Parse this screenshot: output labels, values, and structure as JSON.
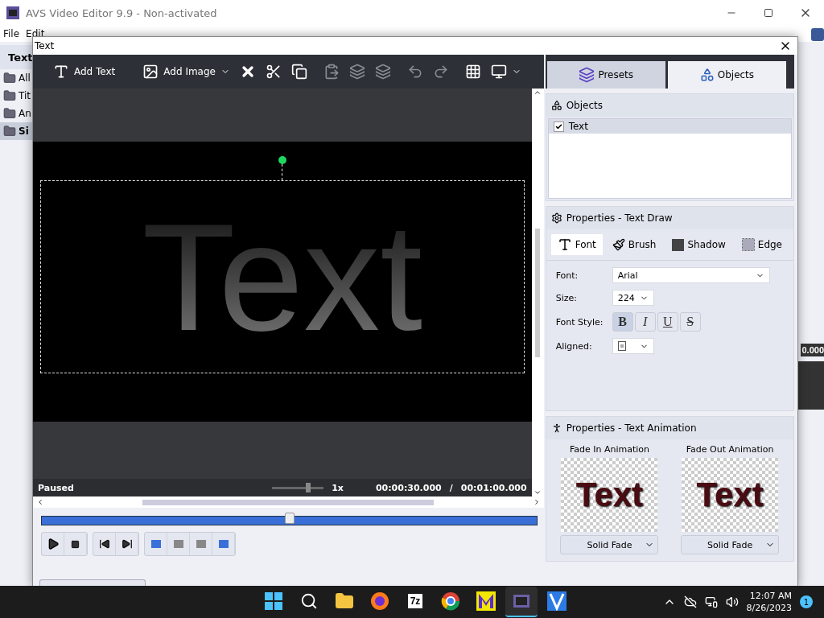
{
  "app": {
    "title": "AVS Video Editor 9.9 - Non-activated",
    "menu": [
      "File",
      "Edit"
    ],
    "sidebar_title": "Text",
    "folders": [
      {
        "label": "All",
        "selected": false
      },
      {
        "label": "Tit",
        "selected": false
      },
      {
        "label": "An",
        "selected": false
      },
      {
        "label": "Si",
        "selected": true
      }
    ],
    "side_reading": "0.000"
  },
  "dialog": {
    "title": "Text"
  },
  "toolbar": [
    {
      "kind": "text",
      "label": "Add Text",
      "disabled": false
    },
    {
      "kind": "image",
      "label": "Add Image",
      "disabled": false
    },
    {
      "kind": "delete",
      "disabled": false
    },
    {
      "kind": "cut",
      "disabled": false
    },
    {
      "kind": "copy",
      "disabled": false
    },
    {
      "kind": "paste",
      "disabled": true
    },
    {
      "kind": "forward",
      "disabled": true
    },
    {
      "kind": "backward",
      "disabled": true
    },
    {
      "kind": "undo",
      "disabled": true
    },
    {
      "kind": "redo",
      "disabled": true
    },
    {
      "kind": "grid",
      "disabled": false
    },
    {
      "kind": "display",
      "disabled": false
    }
  ],
  "tabs": [
    {
      "label": "Presets",
      "selected": false
    },
    {
      "label": "Objects",
      "selected": true
    }
  ],
  "objects": {
    "title": "Objects",
    "items": [
      {
        "label": "Text",
        "checked": true,
        "selected": true
      }
    ]
  },
  "properties": {
    "title": "Properties - Text Draw",
    "subtabs": [
      {
        "kind": "font",
        "label": "Font",
        "selected": true
      },
      {
        "kind": "brush",
        "label": "Brush",
        "selected": false
      },
      {
        "kind": "shadow",
        "label": "Shadow",
        "selected": false
      },
      {
        "kind": "edge",
        "label": "Edge",
        "selected": false
      }
    ],
    "font_label": "Font:",
    "font": "Arial",
    "size_label": "Size:",
    "size": "224",
    "style_label": "Font Style:",
    "styles": [
      {
        "kind": "bold",
        "glyph": "B",
        "on": true
      },
      {
        "kind": "italic",
        "glyph": "I",
        "on": false
      },
      {
        "kind": "underline",
        "glyph": "U",
        "on": false
      },
      {
        "kind": "strike",
        "glyph": "S",
        "on": false
      }
    ],
    "aligned_label": "Aligned:"
  },
  "animation": {
    "title": "Properties - Text Animation",
    "items": [
      {
        "title": "Fade In Animation",
        "sample": "Text",
        "effect": "Solid Fade"
      },
      {
        "title": "Fade Out Animation",
        "sample": "Text",
        "effect": "Solid Fade"
      }
    ]
  },
  "preview": {
    "text": "Text",
    "status": "Paused",
    "speed": {
      "level": 0.7
    },
    "speed_reading": "1x",
    "time": "00:00:30.000",
    "separator": "/",
    "duration": "00:01:00.000"
  },
  "timeline": {
    "level": 0.5
  },
  "taskbar": {
    "apps": [
      {
        "kind": "start",
        "active": false
      },
      {
        "kind": "search",
        "active": false
      },
      {
        "kind": "folder",
        "active": false
      },
      {
        "kind": "browser-fox",
        "active": false
      },
      {
        "kind": "archiver",
        "label": "7z",
        "active": false
      },
      {
        "kind": "browser-round",
        "active": false
      },
      {
        "kind": "m-app",
        "active": false
      },
      {
        "kind": "film",
        "active": true
      },
      {
        "kind": "v-app",
        "active": false
      }
    ],
    "time": "12:07 AM",
    "date": "8/26/2023",
    "badge": "1"
  }
}
